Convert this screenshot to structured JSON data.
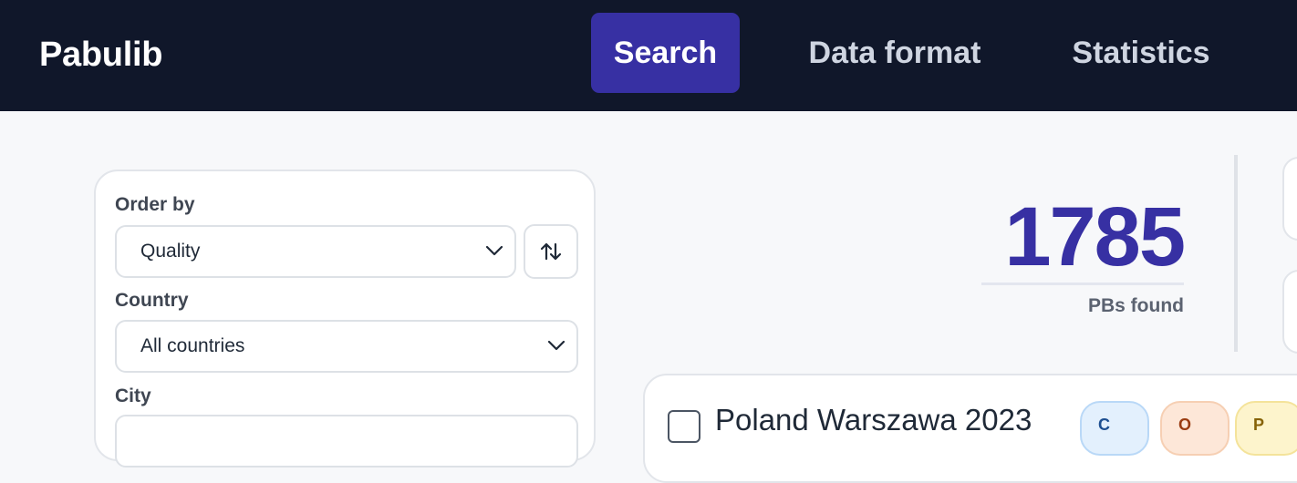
{
  "nav": {
    "brand": "Pabulib",
    "items": [
      {
        "label": "Search",
        "active": true
      },
      {
        "label": "Data format",
        "active": false
      },
      {
        "label": "Statistics",
        "active": false
      }
    ]
  },
  "filters": {
    "order_by": {
      "label": "Order by",
      "value": "Quality"
    },
    "country": {
      "label": "Country",
      "value": "All countries"
    },
    "city": {
      "label": "City"
    }
  },
  "results": {
    "count": "1785",
    "count_label": "PBs found",
    "first_item": {
      "title": "Poland Warszawa 2023",
      "badges": [
        "C",
        "O",
        "P"
      ]
    }
  },
  "colors": {
    "nav_bg": "#10172a",
    "accent": "#3730a3",
    "page_bg": "#f7f8fa"
  },
  "icons": {
    "sort": "sort-arrows-icon",
    "dropdown": "chevron-down-icon"
  }
}
